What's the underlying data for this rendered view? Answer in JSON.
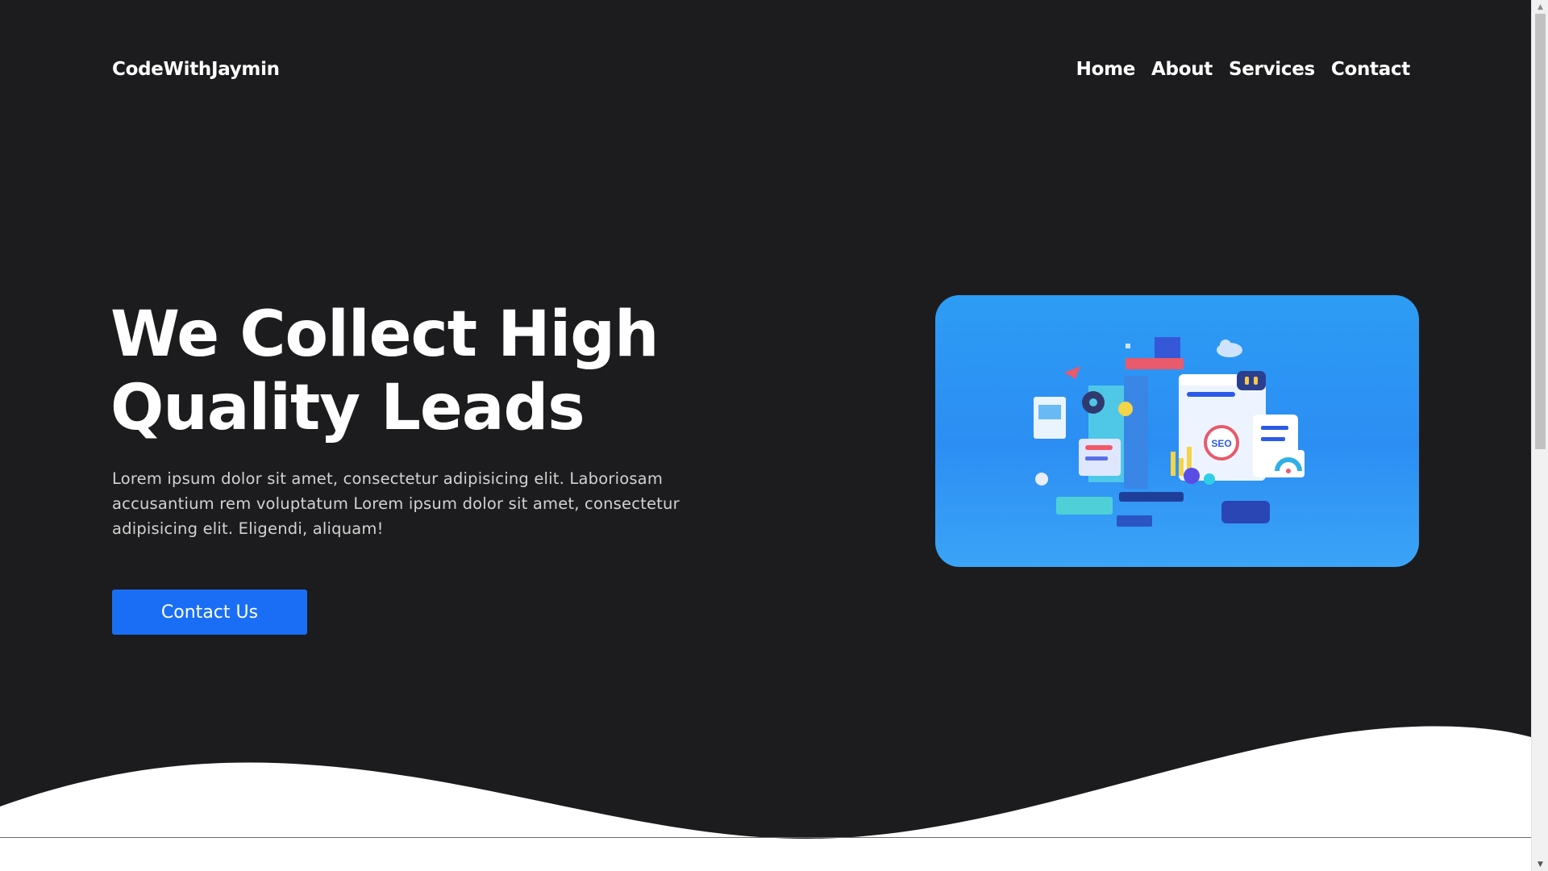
{
  "header": {
    "brand": "CodeWithJaymin",
    "nav": [
      "Home",
      "About",
      "Services",
      "Contact"
    ]
  },
  "hero": {
    "headline_line1": "We Collect High",
    "headline_line2": "Quality Leads",
    "description": "Lorem ipsum dolor sit amet, consectetur adipisicing elit. Laboriosam accusantium rem voluptatum Lorem ipsum dolor sit amet, consectetur adipisicing elit. Eligendi, aliquam!",
    "cta_label": "Contact Us",
    "illustration_badge": "SEO"
  },
  "colors": {
    "background": "#1c1c1e",
    "accent": "#1a6ef5",
    "illustration_bg": "#2c8ef3",
    "wave": "#ffffff"
  },
  "icons": {
    "scroll_up": "triangle-up",
    "scroll_down": "triangle-down"
  }
}
